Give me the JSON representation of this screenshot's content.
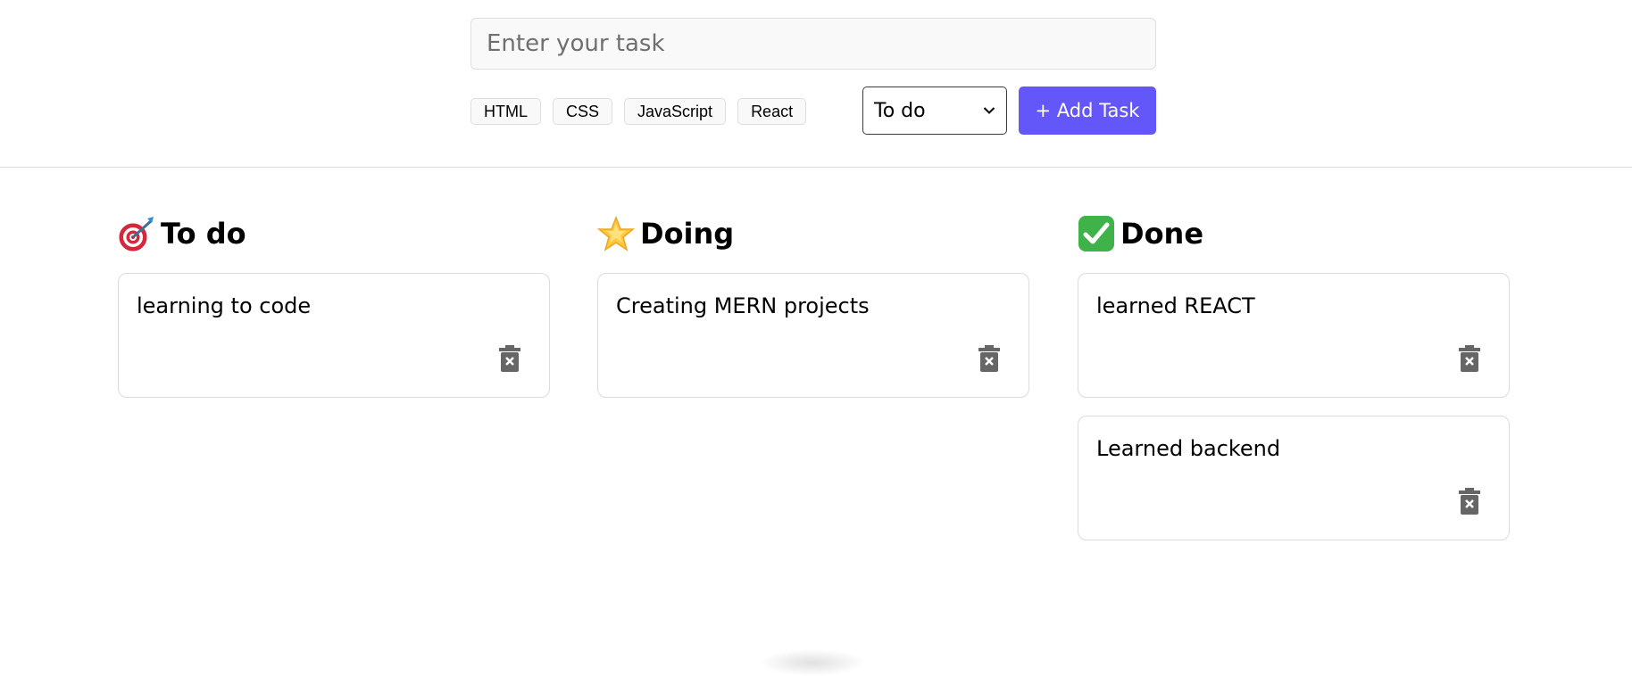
{
  "form": {
    "placeholder": "Enter your task",
    "tags": [
      "HTML",
      "CSS",
      "JavaScript",
      "React"
    ],
    "status_value": "To do",
    "add_label": "+ Add Task"
  },
  "colors": {
    "accent": "#6457f9",
    "border": "#dcdcdc"
  },
  "columns": [
    {
      "title": "To do",
      "icon": "target-icon",
      "cards": [
        "learning to code"
      ]
    },
    {
      "title": "Doing",
      "icon": "star-icon",
      "cards": [
        "Creating MERN projects"
      ]
    },
    {
      "title": "Done",
      "icon": "check-mark-icon",
      "cards": [
        "learned REACT",
        "Learned backend"
      ]
    }
  ]
}
